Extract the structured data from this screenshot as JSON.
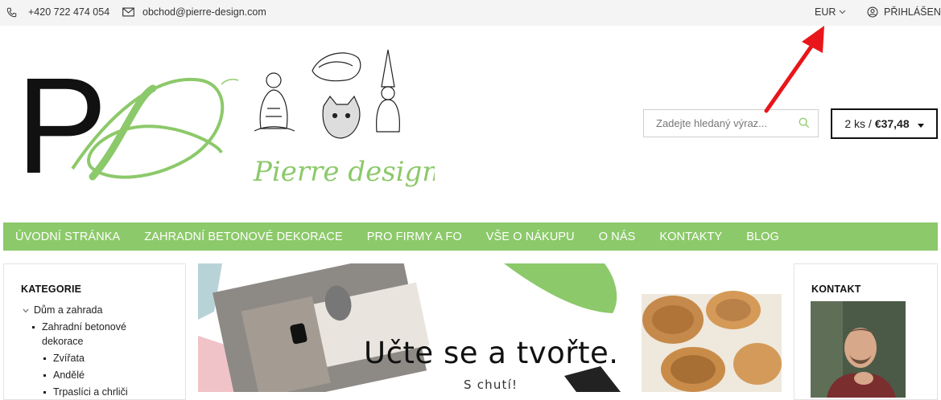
{
  "topbar": {
    "phone": "+420 722 474 054",
    "email": "obchod@pierre-design.com",
    "currency": "EUR",
    "login": "PŘIHLÁŠENÍ"
  },
  "brand": {
    "logo_text": "Pierre design",
    "monogram": "P"
  },
  "search": {
    "placeholder": "Zadejte hledaný výraz..."
  },
  "cart": {
    "count": "2 ks /",
    "total": "€37,48"
  },
  "nav": {
    "items": [
      "ÚVODNÍ STRÁNKA",
      "ZAHRADNÍ BETONOVÉ DEKORACE",
      "PRO FIRMY A FO",
      "VŠE O NÁKUPU",
      "O NÁS",
      "KONTAKTY",
      "BLOG"
    ]
  },
  "categories": {
    "title": "KATEGORIE",
    "root": "Dům a zahrada",
    "sub": "Zahradní betonové dekorace",
    "children": [
      "Zvířata",
      "Andělé",
      "Trpaslíci a chrliči"
    ]
  },
  "banner": {
    "title": "Učte se a tvořte.",
    "subtitle": "S chutí!"
  },
  "contact": {
    "title": "KONTAKT"
  },
  "colors": {
    "accent": "#8cc96a",
    "annotation_arrow": "#e8161b"
  }
}
